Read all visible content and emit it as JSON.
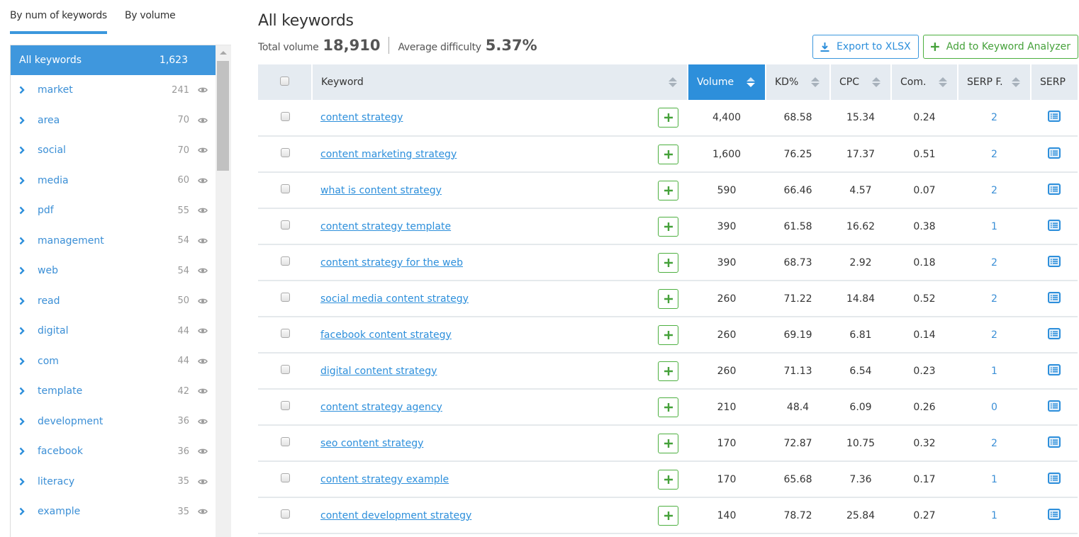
{
  "sidebar": {
    "tabs": [
      {
        "label": "By num of keywords",
        "active": true
      },
      {
        "label": "By volume",
        "active": false
      }
    ],
    "all": {
      "label": "All keywords",
      "count": "1,623"
    },
    "items": [
      {
        "label": "market",
        "count": "241"
      },
      {
        "label": "area",
        "count": "70"
      },
      {
        "label": "social",
        "count": "70"
      },
      {
        "label": "media",
        "count": "60"
      },
      {
        "label": "pdf",
        "count": "55"
      },
      {
        "label": "management",
        "count": "54"
      },
      {
        "label": "web",
        "count": "54"
      },
      {
        "label": "read",
        "count": "50"
      },
      {
        "label": "digital",
        "count": "44"
      },
      {
        "label": "com",
        "count": "44"
      },
      {
        "label": "template",
        "count": "42"
      },
      {
        "label": "development",
        "count": "36"
      },
      {
        "label": "facebook",
        "count": "36"
      },
      {
        "label": "literacy",
        "count": "35"
      },
      {
        "label": "example",
        "count": "35"
      }
    ]
  },
  "main": {
    "title": "All keywords",
    "total_volume_label": "Total volume",
    "total_volume": "18,910",
    "avg_difficulty_label": "Average difficulty",
    "avg_difficulty": "5.37%",
    "export_label": "Export to XLSX",
    "add_label": "Add to Keyword Analyzer"
  },
  "table": {
    "columns": [
      "Keyword",
      "Volume",
      "KD%",
      "CPC",
      "Com.",
      "SERP F.",
      "SERP"
    ],
    "sorted_column": "Volume",
    "rows": [
      {
        "keyword": "content strategy",
        "volume": "4,400",
        "kd": "68.58",
        "cpc": "15.34",
        "com": "0.24",
        "serpf": "2"
      },
      {
        "keyword": "content marketing strategy",
        "volume": "1,600",
        "kd": "76.25",
        "cpc": "17.37",
        "com": "0.51",
        "serpf": "2"
      },
      {
        "keyword": "what is content strategy",
        "volume": "590",
        "kd": "66.46",
        "cpc": "4.57",
        "com": "0.07",
        "serpf": "2"
      },
      {
        "keyword": "content strategy template",
        "volume": "390",
        "kd": "61.58",
        "cpc": "16.62",
        "com": "0.38",
        "serpf": "1"
      },
      {
        "keyword": "content strategy for the web",
        "volume": "390",
        "kd": "68.73",
        "cpc": "2.92",
        "com": "0.18",
        "serpf": "2"
      },
      {
        "keyword": "social media content strategy",
        "volume": "260",
        "kd": "71.22",
        "cpc": "14.84",
        "com": "0.52",
        "serpf": "2"
      },
      {
        "keyword": "facebook content strategy",
        "volume": "260",
        "kd": "69.19",
        "cpc": "6.81",
        "com": "0.14",
        "serpf": "2"
      },
      {
        "keyword": "digital content strategy",
        "volume": "260",
        "kd": "71.13",
        "cpc": "6.54",
        "com": "0.23",
        "serpf": "1"
      },
      {
        "keyword": "content strategy agency",
        "volume": "210",
        "kd": "48.4",
        "cpc": "6.09",
        "com": "0.26",
        "serpf": "0"
      },
      {
        "keyword": "seo content strategy",
        "volume": "170",
        "kd": "72.87",
        "cpc": "10.75",
        "com": "0.32",
        "serpf": "2"
      },
      {
        "keyword": "content strategy example",
        "volume": "170",
        "kd": "65.68",
        "cpc": "7.36",
        "com": "0.17",
        "serpf": "1"
      },
      {
        "keyword": "content development strategy",
        "volume": "140",
        "kd": "78.72",
        "cpc": "25.84",
        "com": "0.27",
        "serpf": "1"
      }
    ]
  },
  "colors": {
    "accent_blue": "#2d8fdb",
    "selected_bg": "#3f97dd",
    "green": "#4caf3f",
    "header_bg": "#e5ebf1"
  }
}
